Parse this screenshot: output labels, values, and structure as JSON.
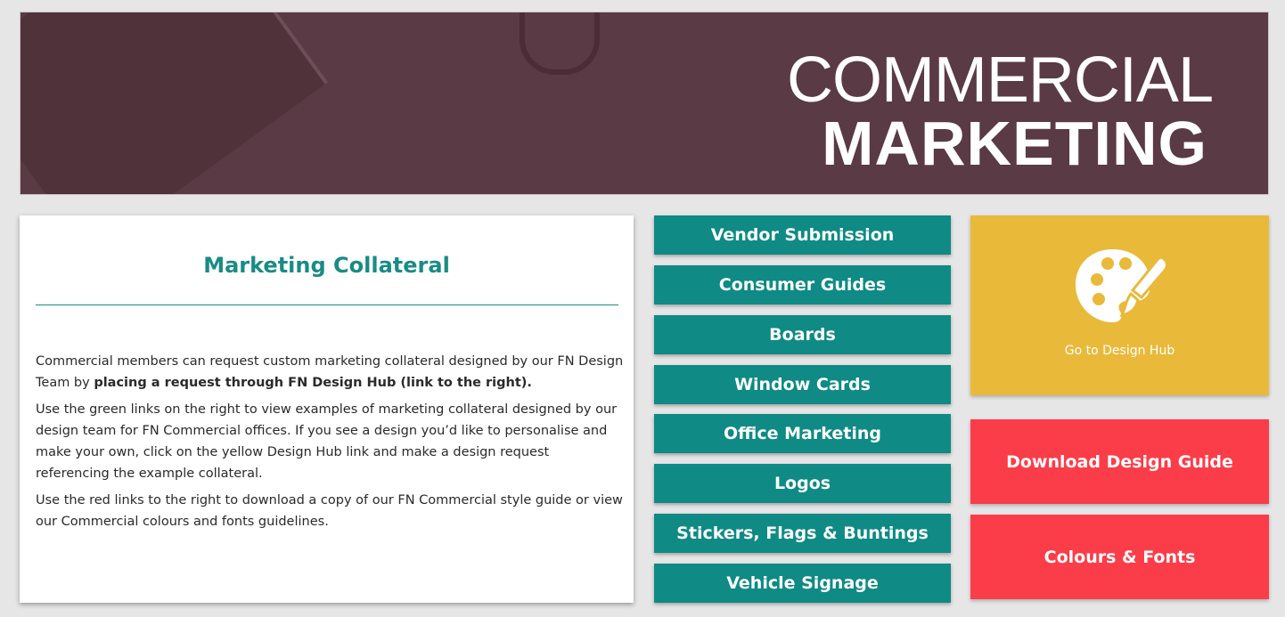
{
  "banner": {
    "line1": "COMMERCIAL",
    "line2": "MARKETING"
  },
  "card": {
    "title": "Marketing Collateral",
    "p1_text": "Commercial members can request custom marketing collateral designed by our FN Design Team by ",
    "p1_bold": "placing a request through FN Design Hub (link to the right).",
    "p2": "Use the green links on the right to view examples of marketing collateral designed by our design team for FN Commercial offices. If you see a design you’d like to personalise and make your own, click on the yellow Design Hub link and make a design request referencing the example collateral.",
    "p3": "Use the red links to the right to download a copy of our FN Commercial style guide or view our Commercial colours and fonts guidelines."
  },
  "green_links": [
    {
      "label": "Vendor Submission"
    },
    {
      "label": "Consumer Guides"
    },
    {
      "label": "Boards"
    },
    {
      "label": "Window Cards"
    },
    {
      "label": "Office Marketing"
    },
    {
      "label": "Logos"
    },
    {
      "label": "Stickers, Flags & Buntings"
    },
    {
      "label": "Vehicle Signage"
    }
  ],
  "design_hub": {
    "label": "Go to Design Hub",
    "icon": "palette-icon"
  },
  "red_links": [
    {
      "label": "Download Design Guide"
    },
    {
      "label": "Colours & Fonts"
    }
  ],
  "colors": {
    "banner_bg": "#5a3a44",
    "teal": "#0f8a84",
    "yellow": "#e9b93a",
    "red": "#fb3d49",
    "page_bg": "#e6e6e6"
  }
}
